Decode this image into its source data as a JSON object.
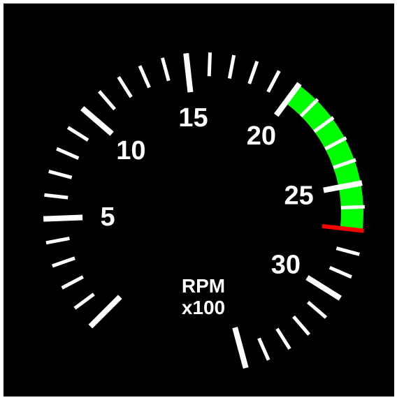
{
  "gauge": {
    "unit_line1": "RPM",
    "unit_line2": "x100",
    "scale_min": 0,
    "scale_max": 35,
    "minor_step": 1,
    "major_labels": [
      {
        "value": 5,
        "label": "5"
      },
      {
        "value": 10,
        "label": "10"
      },
      {
        "value": 15,
        "label": "15"
      },
      {
        "value": 20,
        "label": "20"
      },
      {
        "value": 25,
        "label": "25"
      },
      {
        "value": 30,
        "label": "30"
      }
    ],
    "green_arc": {
      "from": 20,
      "to": 27,
      "color": "#00ff00"
    },
    "redline": {
      "value": 27,
      "color": "#ff0000"
    },
    "background_color": "#000000",
    "tick_color": "#ffffff"
  }
}
